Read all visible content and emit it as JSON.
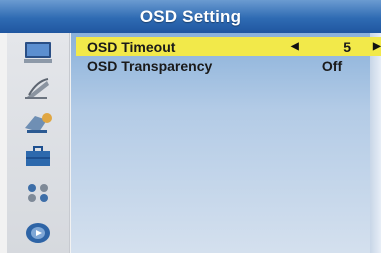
{
  "header": {
    "title": "OSD Setting"
  },
  "sidebar": {
    "items": [
      {
        "icon": "tv-screen-icon"
      },
      {
        "icon": "satellite-dish-icon"
      },
      {
        "icon": "installation-setup-icon"
      },
      {
        "icon": "toolbox-icon"
      },
      {
        "icon": "multimedia-icon"
      },
      {
        "icon": "media-player-icon"
      }
    ]
  },
  "settings": {
    "rows": [
      {
        "label": "OSD Timeout",
        "value": "5",
        "selected": true
      },
      {
        "label": "OSD Transparency",
        "value": "Off",
        "selected": false
      }
    ]
  },
  "colors": {
    "title_bar": "#2f6bb3",
    "selected_row": "#f2e94a",
    "panel": "#b3cbe6"
  }
}
